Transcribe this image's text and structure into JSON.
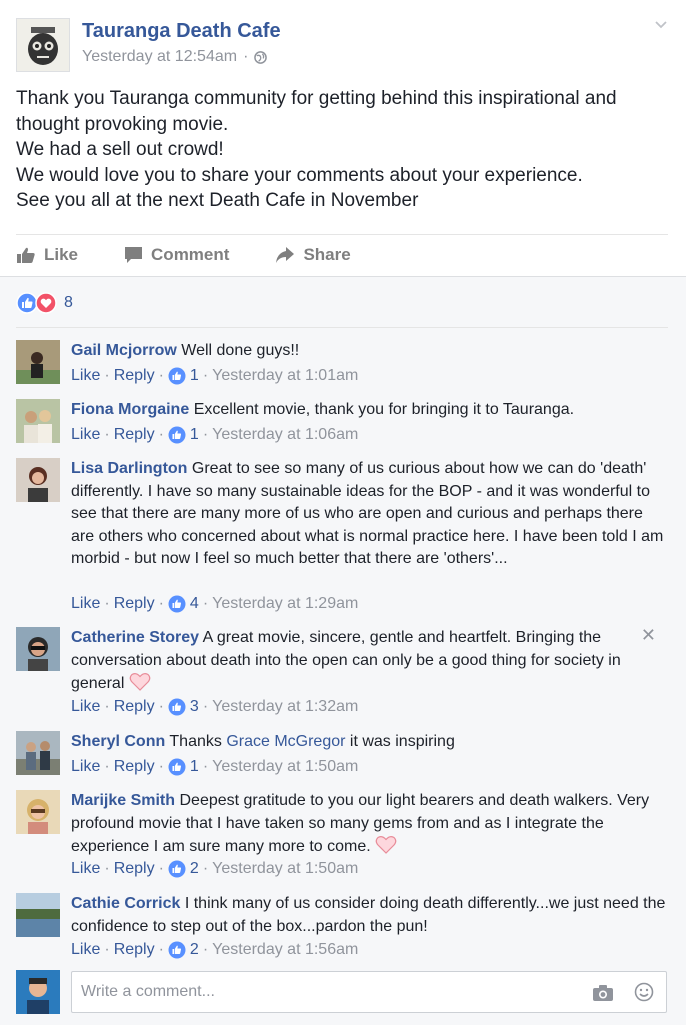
{
  "post": {
    "page_name": "Tauranga Death Cafe",
    "timestamp": "Yesterday at 12:54am",
    "privacy_icon": "globe-icon",
    "text_lines": [
      "Thank you Tauranga community for getting behind this inspirational and",
      "thought provoking movie.",
      "We had a sell out crowd!",
      "We would love you to share your comments about your experience.",
      "See you all at the next Death Cafe in November"
    ],
    "actions": {
      "like": "Like",
      "comment": "Comment",
      "share": "Share"
    },
    "reaction_count": "8"
  },
  "comments": [
    {
      "name": "Gail Mcjorrow",
      "mention": "",
      "text": "Well done guys!!",
      "text_after": "",
      "like": "Like",
      "reply": "Reply",
      "likes": "1",
      "time": "Yesterday at 1:01am",
      "heart": false
    },
    {
      "name": "Fiona Morgaine",
      "mention": "",
      "text": "Excellent movie, thank you for bringing it to Tauranga.",
      "text_after": "",
      "like": "Like",
      "reply": "Reply",
      "likes": "1",
      "time": "Yesterday at 1:06am",
      "heart": false
    },
    {
      "name": "Lisa Darlington",
      "mention": "",
      "text": "Great to see so many of us curious about how we can do 'death' differently. I have so many sustainable ideas for the BOP - and it was wonderful to see that there are many more of us who are open and curious and perhaps there are others who concerned about what is normal practice here. I have been told I am morbid - but now I feel so much better that there are 'others'...",
      "text_after": "",
      "like": "Like",
      "reply": "Reply",
      "likes": "4",
      "time": "Yesterday at 1:29am",
      "heart": false
    },
    {
      "name": "Catherine Storey",
      "mention": "",
      "text": "A great movie, sincere, gentle and heartfelt. Bringing the conversation about death into the open can only be a good thing for society in general",
      "text_after": "",
      "like": "Like",
      "reply": "Reply",
      "likes": "3",
      "time": "Yesterday at 1:32am",
      "heart": true
    },
    {
      "name": "Sheryl Conn",
      "mention": "Grace McGregor",
      "text": "Thanks",
      "text_after": "it was inspiring",
      "like": "Like",
      "reply": "Reply",
      "likes": "1",
      "time": "Yesterday at 1:50am",
      "heart": false
    },
    {
      "name": "Marijke Smith",
      "mention": "",
      "text": "Deepest gratitude to you our light bearers and death walkers. Very profound movie that I have taken so many gems from and as I integrate the experience I am sure many more to come.",
      "text_after": "",
      "like": "Like",
      "reply": "Reply",
      "likes": "2",
      "time": "Yesterday at 1:50am",
      "heart": true
    },
    {
      "name": "Cathie Corrick",
      "mention": "",
      "text": "I think many of us consider doing death differently...we just need the confidence to step out of the box...pardon the pun!",
      "text_after": "",
      "like": "Like",
      "reply": "Reply",
      "likes": "2",
      "time": "Yesterday at 1:56am",
      "heart": false
    }
  ],
  "composer": {
    "placeholder": "Write a comment..."
  },
  "colors": {
    "link": "#365899",
    "like_blue": "#5890ff",
    "love_red": "#f25268",
    "muted": "#90949c"
  }
}
